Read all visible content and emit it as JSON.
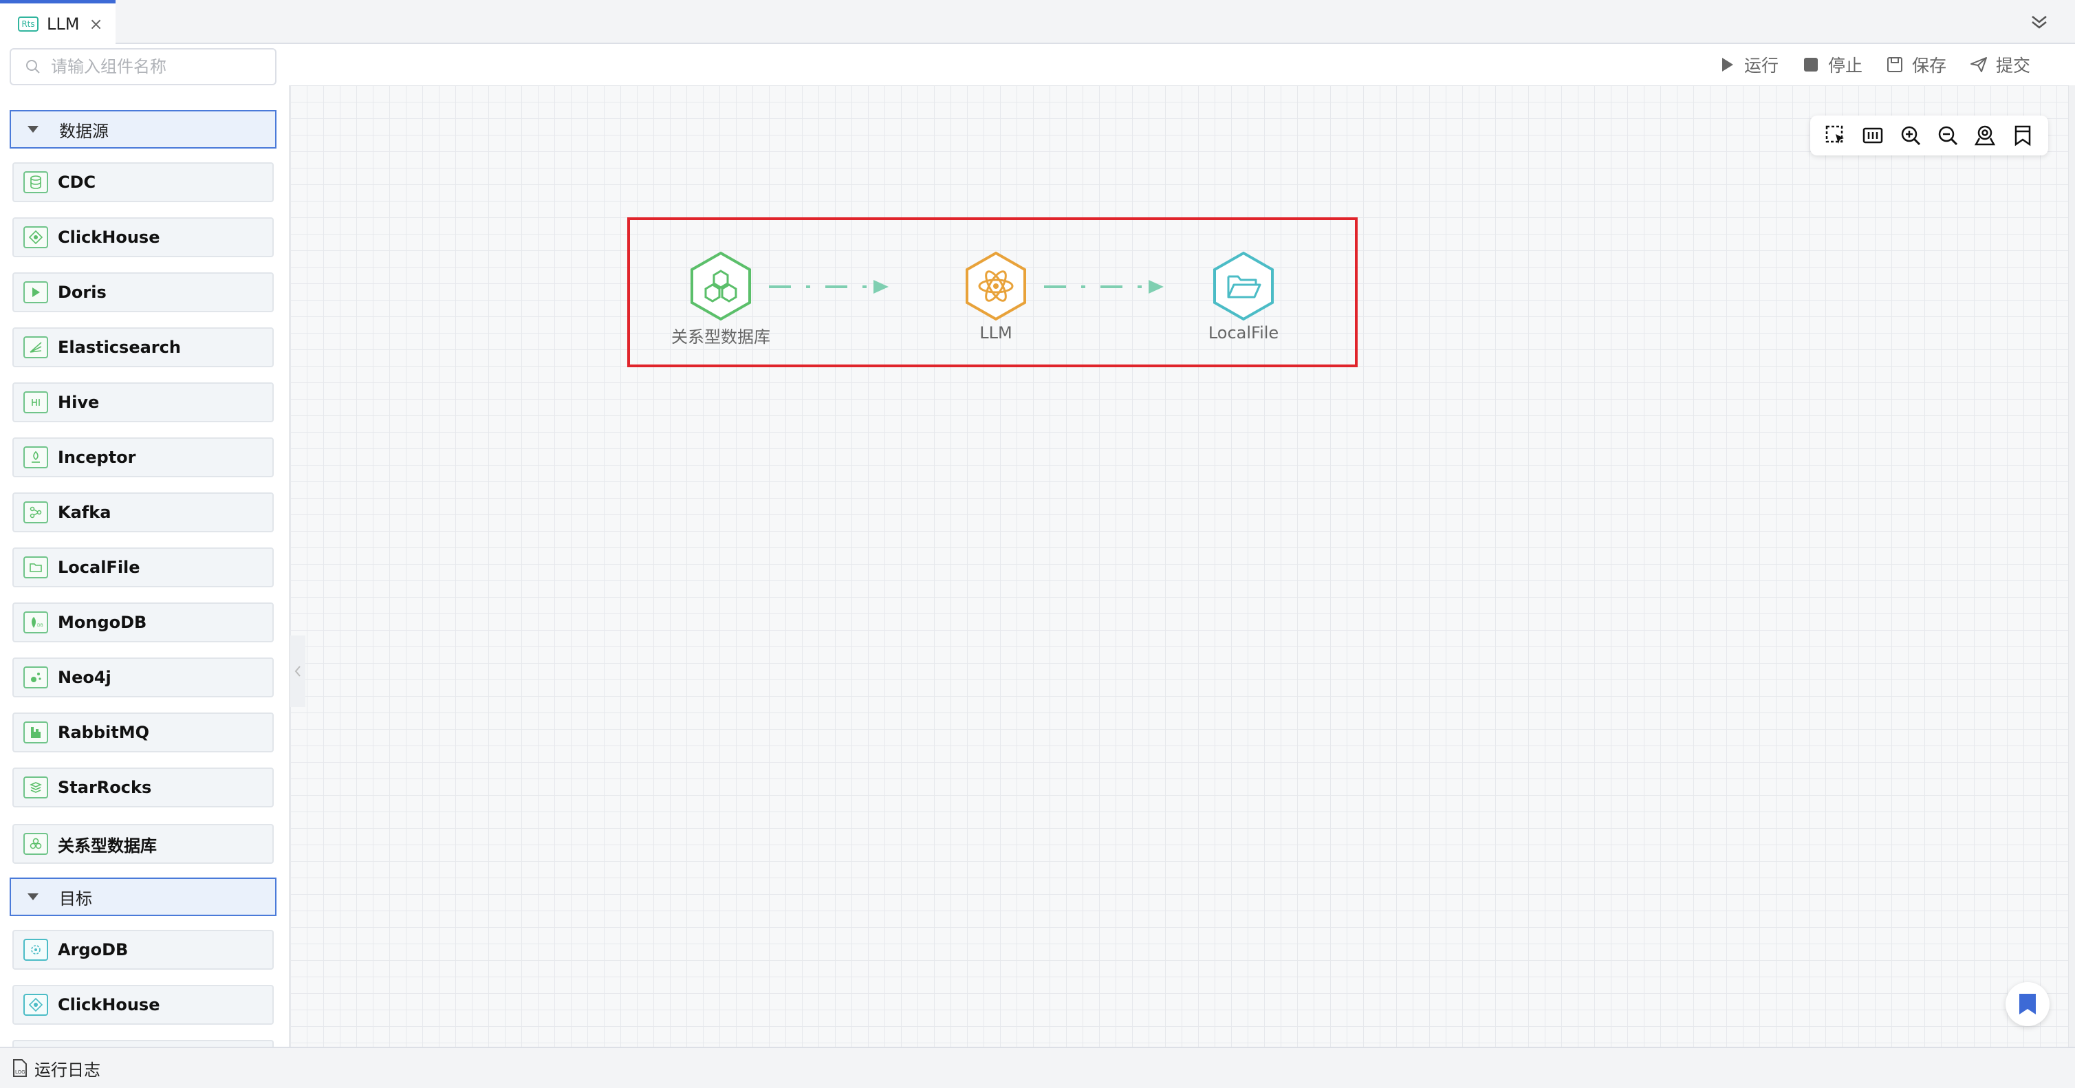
{
  "tab": {
    "badge": "Rts",
    "label": "LLM",
    "close": "×"
  },
  "toolbar": {
    "run": "运行",
    "stop": "停止",
    "save": "保存",
    "submit": "提交"
  },
  "sidebar": {
    "search_placeholder": "请输入组件名称",
    "groups": [
      {
        "label": "数据源"
      },
      {
        "label": "目标"
      }
    ],
    "source_items": [
      {
        "label": "CDC"
      },
      {
        "label": "ClickHouse"
      },
      {
        "label": "Doris"
      },
      {
        "label": "Elasticsearch"
      },
      {
        "label": "Hive"
      },
      {
        "label": "Inceptor"
      },
      {
        "label": "Kafka"
      },
      {
        "label": "LocalFile"
      },
      {
        "label": "MongoDB"
      },
      {
        "label": "Neo4j"
      },
      {
        "label": "RabbitMQ"
      },
      {
        "label": "StarRocks"
      },
      {
        "label": "关系型数据库"
      }
    ],
    "target_items": [
      {
        "label": "ArgoDB"
      },
      {
        "label": "ClickHouse"
      }
    ]
  },
  "canvas": {
    "nodes": [
      {
        "label": "关系型数据库",
        "color": "#5bbf6a"
      },
      {
        "label": "LLM",
        "color": "#e8a23a"
      },
      {
        "label": "LocalFile",
        "color": "#4bbcc6"
      }
    ],
    "edge_color": "#7fcfb1",
    "selection_color": "#e0242b"
  },
  "statusbar": {
    "log_label": "运行日志"
  },
  "colors": {
    "accent": "#3d6ad6",
    "icon_gray": "#666666",
    "bookmark": "#3d6ad6"
  }
}
